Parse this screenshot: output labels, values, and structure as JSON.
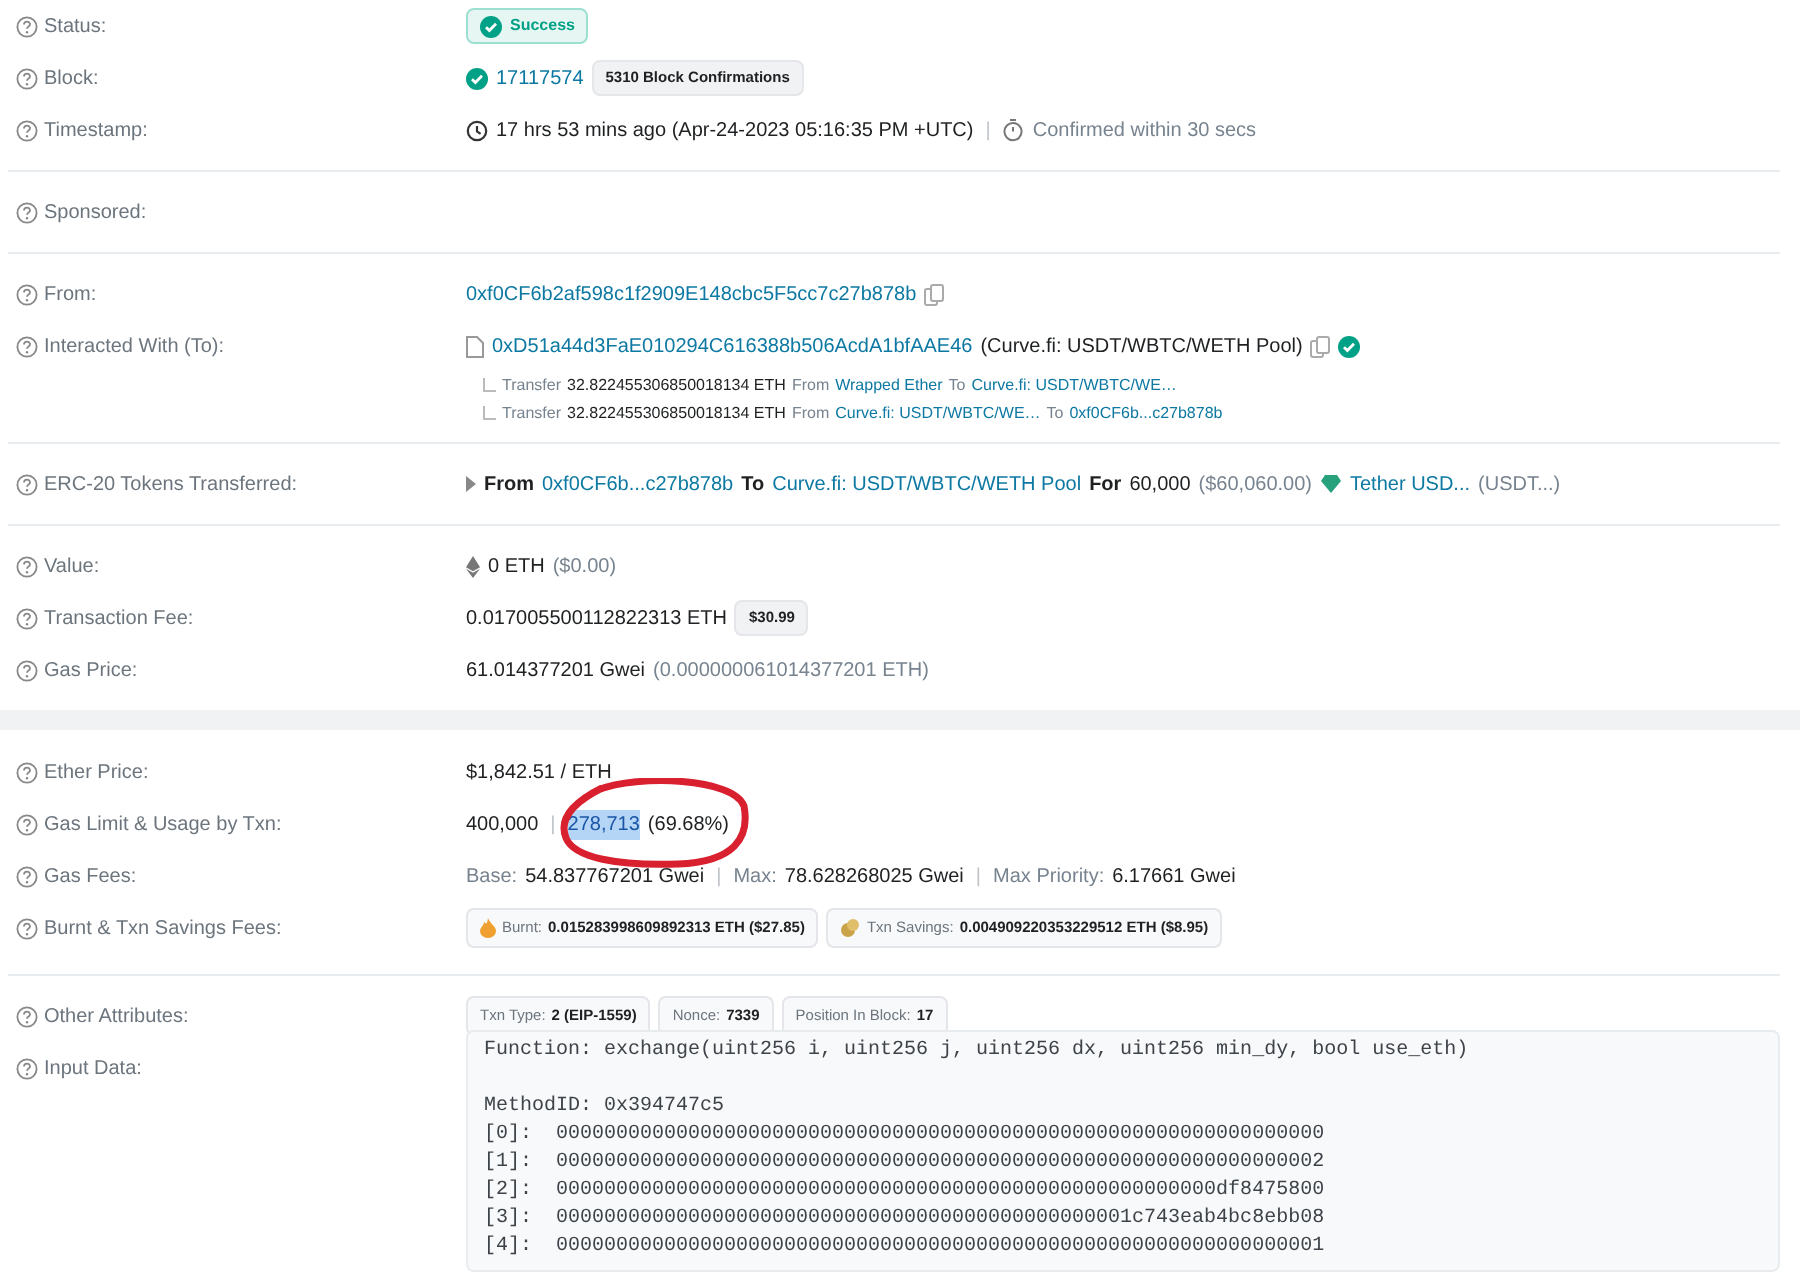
{
  "cards": [
    {
      "sections": [
        {
          "rows": [
            {
              "label": "Status:",
              "lines": [
                {
                  "kind": "main",
                  "parts": [
                    {
                      "kind": "success",
                      "text": "Success"
                    }
                  ]
                }
              ]
            },
            {
              "label": "Block:",
              "lines": [
                {
                  "kind": "main",
                  "parts": [
                    {
                      "kind": "check"
                    },
                    {
                      "kind": "link",
                      "text": "17117574"
                    },
                    {
                      "kind": "badge",
                      "text": "5310 Block Confirmations"
                    }
                  ]
                }
              ]
            },
            {
              "label": "Timestamp:",
              "lines": [
                {
                  "kind": "main",
                  "parts": [
                    {
                      "kind": "clock"
                    },
                    {
                      "kind": "text",
                      "text": "17 hrs 53 mins ago (Apr-24-2023 05:16:35 PM +UTC)"
                    },
                    {
                      "kind": "sep",
                      "text": "|"
                    },
                    {
                      "kind": "timer"
                    },
                    {
                      "kind": "muted",
                      "text": "Confirmed within 30 secs"
                    }
                  ]
                }
              ]
            }
          ]
        },
        {
          "rows": [
            {
              "label": "Sponsored:"
            }
          ]
        },
        {
          "rows": [
            {
              "label": "From:",
              "lines": [
                {
                  "kind": "main",
                  "parts": [
                    {
                      "kind": "link",
                      "text": "0xf0CF6b2af598c1f2909E148cbc5F5cc7c27b878b"
                    },
                    {
                      "kind": "copy"
                    }
                  ]
                }
              ]
            },
            {
              "label": "Interacted With (To):",
              "lines": [
                {
                  "kind": "main",
                  "parts": [
                    {
                      "kind": "file"
                    },
                    {
                      "kind": "link",
                      "text": "0xD51a44d3FaE010294C616388b506AcdA1bfAAE46"
                    },
                    {
                      "kind": "text",
                      "text": "(Curve.fi: USDT/WBTC/WETH Pool)"
                    },
                    {
                      "kind": "copy"
                    },
                    {
                      "kind": "verified"
                    }
                  ]
                },
                {
                  "kind": "sub",
                  "parts": [
                    {
                      "kind": "branch"
                    },
                    {
                      "kind": "muted",
                      "text": "Transfer"
                    },
                    {
                      "kind": "text",
                      "text": "32.822455306850018134 ETH"
                    },
                    {
                      "kind": "muted",
                      "text": "From"
                    },
                    {
                      "kind": "link",
                      "text": "Wrapped Ether"
                    },
                    {
                      "kind": "muted",
                      "text": "To"
                    },
                    {
                      "kind": "link",
                      "text": "Curve.fi: USDT/WBTC/WE…"
                    }
                  ]
                },
                {
                  "kind": "sub",
                  "parts": [
                    {
                      "kind": "branch"
                    },
                    {
                      "kind": "muted",
                      "text": "Transfer"
                    },
                    {
                      "kind": "text",
                      "text": "32.822455306850018134 ETH"
                    },
                    {
                      "kind": "muted",
                      "text": "From"
                    },
                    {
                      "kind": "link",
                      "text": "Curve.fi: USDT/WBTC/WE…"
                    },
                    {
                      "kind": "muted",
                      "text": "To"
                    },
                    {
                      "kind": "link",
                      "text": "0xf0CF6b...c27b878b"
                    }
                  ]
                }
              ]
            }
          ]
        },
        {
          "rows": [
            {
              "label": "ERC-20 Tokens Transferred:",
              "lines": [
                {
                  "kind": "main",
                  "parts": [
                    {
                      "kind": "caret"
                    },
                    {
                      "kind": "bold",
                      "text": "From"
                    },
                    {
                      "kind": "link",
                      "text": "0xf0CF6b...c27b878b"
                    },
                    {
                      "kind": "bold",
                      "text": "To"
                    },
                    {
                      "kind": "link",
                      "text": "Curve.fi: USDT/WBTC/WETH Pool"
                    },
                    {
                      "kind": "bold",
                      "text": "For"
                    },
                    {
                      "kind": "text",
                      "text": "60,000"
                    },
                    {
                      "kind": "muted",
                      "text": "($60,060.00)"
                    },
                    {
                      "kind": "diamond"
                    },
                    {
                      "kind": "link",
                      "text": "Tether USD..."
                    },
                    {
                      "kind": "muted",
                      "text": "(USDT...)"
                    }
                  ]
                }
              ]
            }
          ]
        },
        {
          "rows": [
            {
              "label": "Value:",
              "lines": [
                {
                  "kind": "main",
                  "parts": [
                    {
                      "kind": "eth"
                    },
                    {
                      "kind": "text",
                      "text": "0 ETH"
                    },
                    {
                      "kind": "muted",
                      "text": "($0.00)"
                    }
                  ]
                }
              ]
            },
            {
              "label": "Transaction Fee:",
              "lines": [
                {
                  "kind": "main",
                  "parts": [
                    {
                      "kind": "text",
                      "text": "0.017005500112822313 ETH"
                    },
                    {
                      "kind": "badge",
                      "text": "$30.99"
                    }
                  ]
                }
              ]
            },
            {
              "label": "Gas Price:",
              "lines": [
                {
                  "kind": "main",
                  "parts": [
                    {
                      "kind": "text",
                      "text": "61.014377201 Gwei"
                    },
                    {
                      "kind": "muted",
                      "text": "(0.000000061014377201 ETH)"
                    }
                  ]
                }
              ]
            }
          ]
        }
      ]
    },
    {
      "sections": [
        {
          "rows": [
            {
              "label": "Ether Price:",
              "lines": [
                {
                  "kind": "main",
                  "parts": [
                    {
                      "kind": "text",
                      "text": "$1,842.51 / ETH"
                    }
                  ]
                }
              ]
            },
            {
              "label": "Gas Limit & Usage by Txn:",
              "circled": true,
              "lines": [
                {
                  "kind": "main",
                  "parts": [
                    {
                      "kind": "text",
                      "text": "400,000"
                    },
                    {
                      "kind": "sep",
                      "text": "|"
                    },
                    {
                      "kind": "text",
                      "text": "278,713",
                      "highlighted": true
                    },
                    {
                      "kind": "text",
                      "text": "(69.68%)"
                    }
                  ]
                }
              ]
            },
            {
              "label": "Gas Fees:",
              "lines": [
                {
                  "kind": "main",
                  "parts": [
                    {
                      "kind": "muted",
                      "text": "Base:"
                    },
                    {
                      "kind": "text",
                      "text": "54.837767201 Gwei"
                    },
                    {
                      "kind": "sep",
                      "text": "|"
                    },
                    {
                      "kind": "muted",
                      "text": "Max:"
                    },
                    {
                      "kind": "text",
                      "text": "78.628268025 Gwei"
                    },
                    {
                      "kind": "sep",
                      "text": "|"
                    },
                    {
                      "kind": "muted",
                      "text": "Max Priority:"
                    },
                    {
                      "kind": "text",
                      "text": "6.17661 Gwei"
                    }
                  ]
                }
              ]
            },
            {
              "label": "Burnt & Txn Savings Fees:",
              "lines": [
                {
                  "kind": "main",
                  "parts": [
                    {
                      "kind": "burnt_pill",
                      "label": "Burnt:",
                      "value": "0.015283998609892313 ETH ($27.85)"
                    },
                    {
                      "kind": "savings_pill",
                      "label": "Txn Savings:",
                      "value": "0.004909220353229512 ETH ($8.95)"
                    }
                  ]
                }
              ]
            }
          ]
        },
        {
          "rows": [
            {
              "label": "Other Attributes:",
              "lines": [
                {
                  "kind": "main",
                  "parts": [
                    {
                      "kind": "pill",
                      "label": "Txn Type:",
                      "value": "2 (EIP-1559)"
                    },
                    {
                      "kind": "pill",
                      "label": "Nonce:",
                      "value": "7339"
                    },
                    {
                      "kind": "pill",
                      "label": "Position In Block:",
                      "value": "17"
                    }
                  ]
                }
              ]
            },
            {
              "label": "Input Data:",
              "code": {
                "signature": "Function: exchange(uint256 i, uint256 j, uint256 dx, uint256 min_dy, bool use_eth)",
                "lines": [
                  "MethodID: 0x394747c5",
                  "[0]:  0000000000000000000000000000000000000000000000000000000000000000",
                  "[1]:  0000000000000000000000000000000000000000000000000000000000000002",
                  "[2]:  0000000000000000000000000000000000000000000000000000000df8475800",
                  "[3]:  000000000000000000000000000000000000000000000001c743eab4bc8ebb08",
                  "[4]:  0000000000000000000000000000000000000000000000000000000000000001"
                ]
              }
            }
          ]
        }
      ]
    }
  ]
}
